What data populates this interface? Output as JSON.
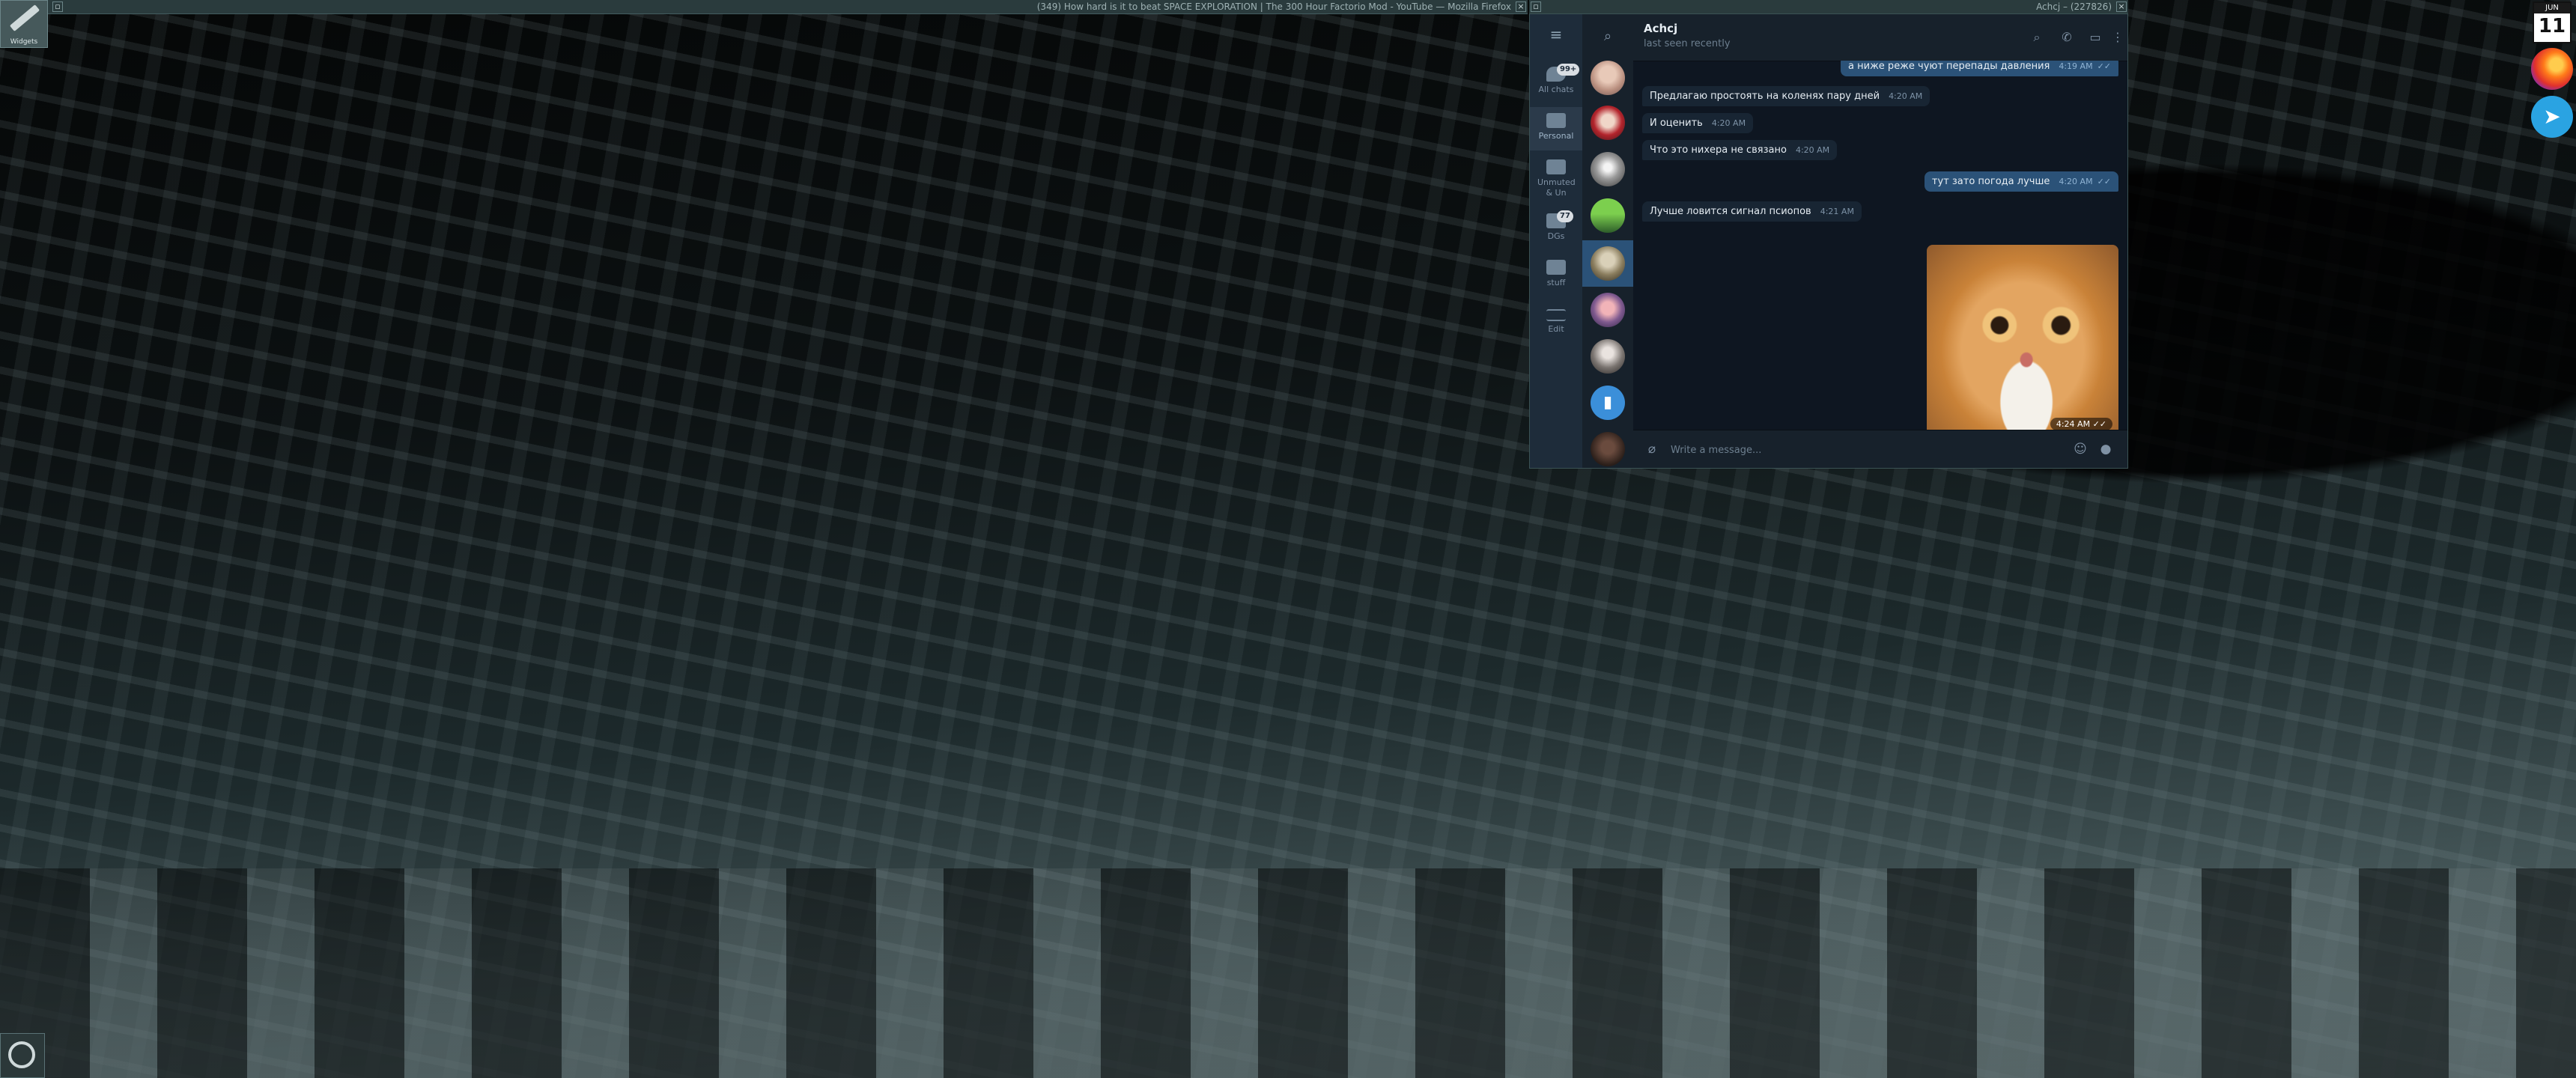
{
  "desktop": {
    "widgets_label": "Widgets"
  },
  "firefox_window": {
    "title": "(349) How hard is it to beat SPACE EXPLORATION | The 300 Hour Factorio Mod - YouTube — Mozilla Firefox"
  },
  "telegram_window": {
    "title": "Achcj – (227826)"
  },
  "telegram": {
    "folders": [
      {
        "label": "All chats",
        "badge": "99+",
        "icon": "chat-bubbles-icon"
      },
      {
        "label": "Personal",
        "badge": "",
        "icon": "folder-icon"
      },
      {
        "label": "Unmuted & Un",
        "badge": "",
        "icon": "folder-icon"
      },
      {
        "label": "DGs",
        "badge": "77",
        "icon": "folder-icon"
      },
      {
        "label": "stuff",
        "badge": "",
        "icon": "folder-icon"
      },
      {
        "label": "Edit",
        "badge": "",
        "icon": "edit-folders-icon"
      }
    ],
    "chat_header": {
      "name": "Achcj",
      "status": "last seen recently"
    },
    "messages": [
      {
        "dir": "out",
        "text": "а ниже реже чуют перепады давления",
        "time": "4:19 AM"
      },
      {
        "dir": "in",
        "text": "Предлагаю простоять на коленях пару дней",
        "time": "4:20 AM"
      },
      {
        "dir": "in",
        "text": "И оценить",
        "time": "4:20 AM"
      },
      {
        "dir": "in",
        "text": "Что это нихера не связано",
        "time": "4:20 AM"
      },
      {
        "dir": "out",
        "text": "тут зато погода лучше",
        "time": "4:20 AM"
      },
      {
        "dir": "in",
        "text": "Лучше ловится сигнал псиопов",
        "time": "4:21 AM"
      }
    ],
    "photo": {
      "time": "4:24 AM"
    },
    "composer": {
      "placeholder": "Write a message..."
    }
  },
  "dock": {
    "calendar_month": "JUN",
    "calendar_day": "11"
  }
}
